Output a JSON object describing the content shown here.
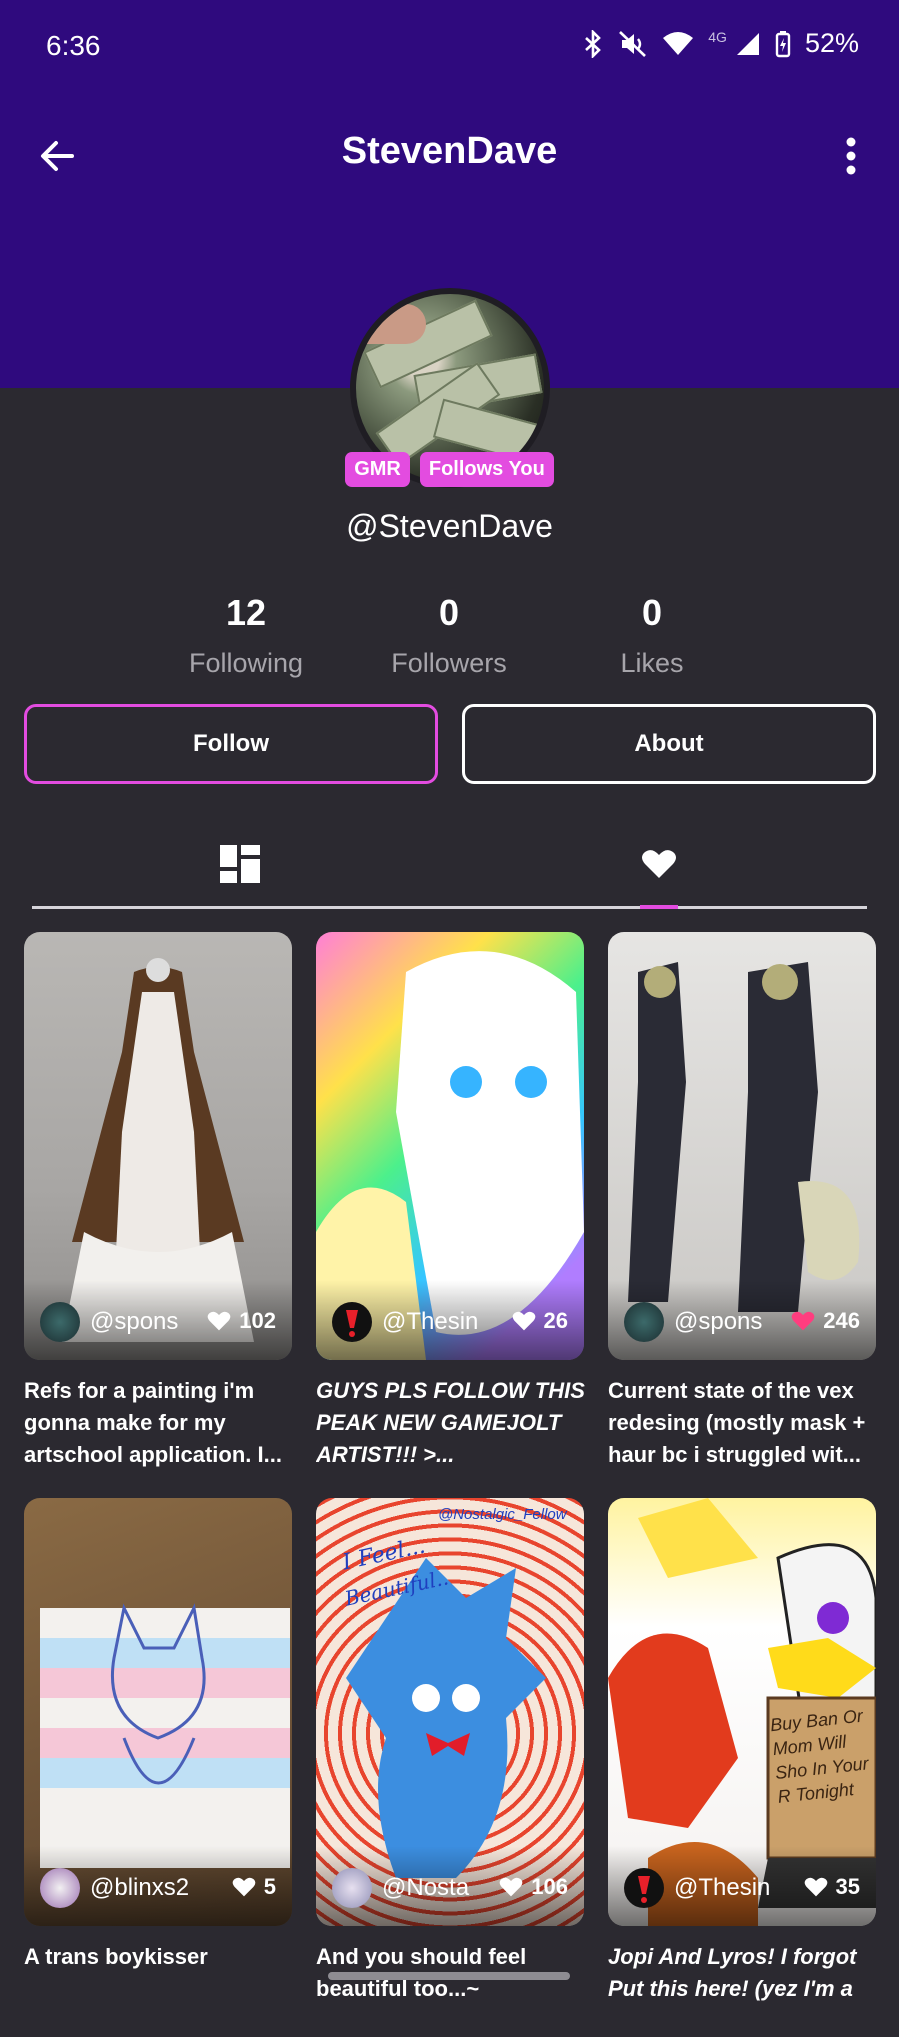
{
  "status_bar": {
    "time": "6:36",
    "network": "4G",
    "battery": "52%"
  },
  "app_bar": {
    "title": "StevenDave"
  },
  "profile": {
    "badges": [
      "GMR",
      "Follows You"
    ],
    "handle": "@StevenDave",
    "stats": [
      {
        "value": "12",
        "label": "Following"
      },
      {
        "value": "0",
        "label": "Followers"
      },
      {
        "value": "0",
        "label": "Likes"
      }
    ],
    "follow_label": "Follow",
    "about_label": "About"
  },
  "tabs": [
    {
      "icon": "posts-grid-icon",
      "active": false
    },
    {
      "icon": "heart-icon",
      "active": true
    }
  ],
  "posts": [
    {
      "user": "@spons",
      "likes": "102",
      "liked": false,
      "caption": "Refs for a painting i'm gonna make for my artschool application. I..."
    },
    {
      "user": "@Thesin",
      "likes": "26",
      "liked": false,
      "caption": " GUYS PLS FOLLOW THIS PEAK NEW GAMEJOLT ARTIST!!! >..."
    },
    {
      "user": "@spons",
      "likes": "246",
      "liked": true,
      "caption": "Current state of the vex redesing (mostly mask + haur bc i struggled wit..."
    },
    {
      "user": "@blinxs2",
      "likes": "5",
      "liked": false,
      "caption": "A trans boykisser"
    },
    {
      "user": "@Nosta",
      "likes": "106",
      "liked": false,
      "caption": "And you should feel beautiful too...~"
    },
    {
      "user": "@Thesin",
      "likes": "35",
      "liked": false,
      "caption": "Jopi And Lyros! I forgot Put this here! (yez I'm a"
    }
  ],
  "post_artwork_text": {
    "p5_text1": "I Feel...",
    "p5_text2": "Beautiful..",
    "p5_watermark": "@Nostalgic_Fellow",
    "p6_sign": "Buy Ban Or Mom Will Sho In Your R Tonight"
  },
  "colors": {
    "header": "#2f0a7e",
    "background": "#2b2930",
    "accent": "#e34ce0"
  }
}
